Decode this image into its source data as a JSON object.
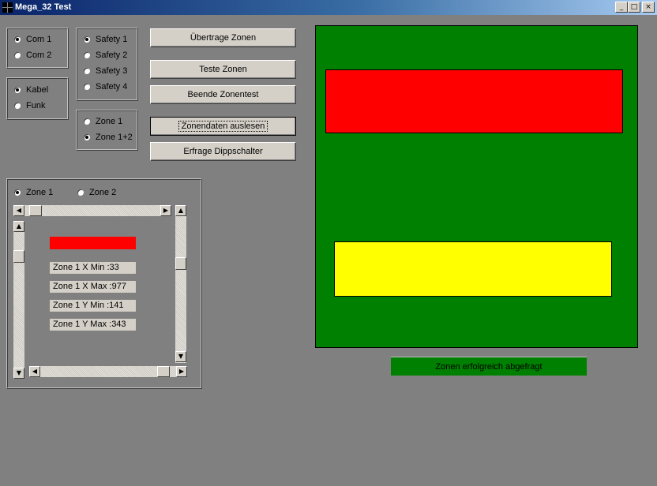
{
  "window": {
    "title": "Mega_32 Test",
    "controls": {
      "minimize": "_",
      "maximize": "□",
      "close": "×"
    }
  },
  "port_group": {
    "options": [
      "Com 1",
      "Com 2"
    ],
    "selected": "Com 1"
  },
  "connection_group": {
    "options": [
      "Kabel",
      "Funk"
    ],
    "selected": "Kabel"
  },
  "safety_group": {
    "options": [
      "Safety 1",
      "Safety 2",
      "Safety 3",
      "Safety 4"
    ],
    "selected": "Safety 1"
  },
  "zone_mode_group": {
    "options": [
      "Zone 1",
      "Zone 1+2"
    ],
    "selected": "Zone 1+2"
  },
  "buttons": {
    "transfer": "Übertrage Zonen",
    "test": "Teste Zonen",
    "end_test": "Beende Zonentest",
    "read": "Zonendaten auslesen",
    "dip": "Erfrage Dippschalter"
  },
  "zone_editor": {
    "zone_options": [
      "Zone 1",
      "Zone 2"
    ],
    "selected": "Zone 1",
    "x_min": "Zone 1 X Min :33",
    "x_max": "Zone 1 X Max :977",
    "y_min": "Zone 1 Y Min :141",
    "y_max": "Zone 1 Y Max :343",
    "zone_color": "#ff0000"
  },
  "preview": {
    "background": "#008000",
    "zone1_color": "#ff0000",
    "zone2_color": "#ffff00"
  },
  "status": {
    "text": "Zonen erfolgreich abgefragt",
    "background": "#008000"
  }
}
